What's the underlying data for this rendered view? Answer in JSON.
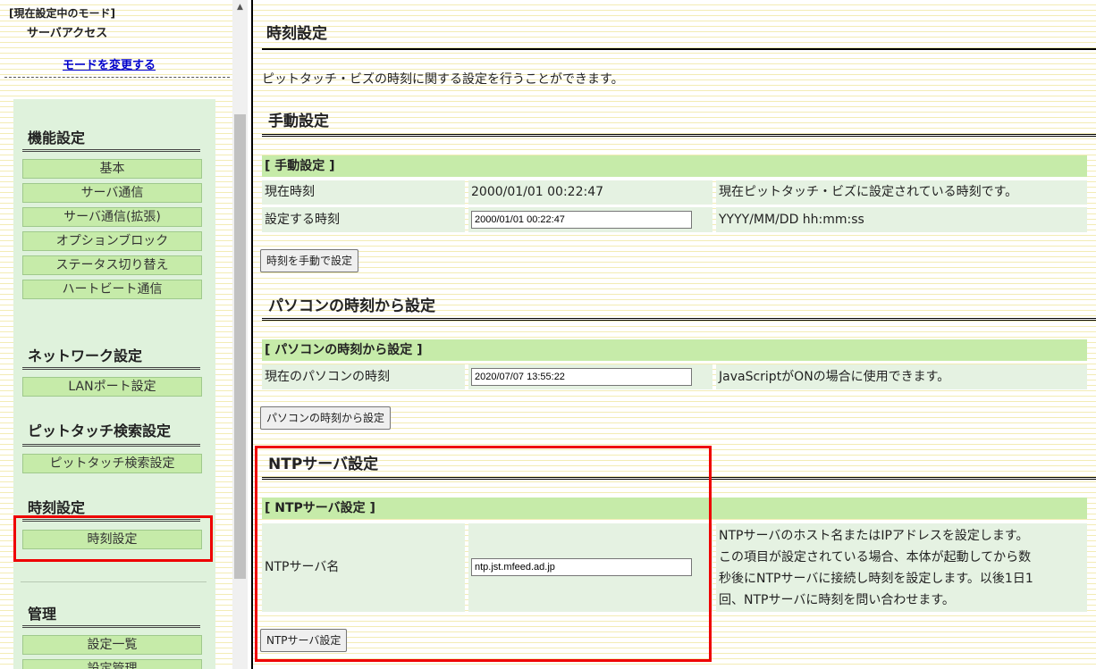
{
  "left": {
    "mode_label": "[現在設定中のモード]",
    "mode_value": "サーバアクセス",
    "change_mode_link": "モードを変更する",
    "sections": {
      "function": {
        "title": "機能設定",
        "items": [
          "基本",
          "サーバ通信",
          "サーバ通信(拡張)",
          "オプションブロック",
          "ステータス切り替え",
          "ハートビート通信"
        ]
      },
      "network": {
        "title": "ネットワーク設定",
        "items": [
          "LANポート設定"
        ]
      },
      "search": {
        "title": "ピットタッチ検索設定",
        "items": [
          "ピットタッチ検索設定"
        ]
      },
      "time": {
        "title": "時刻設定",
        "items": [
          "時刻設定"
        ]
      },
      "admin": {
        "title": "管理",
        "items": [
          "設定一覧",
          "設定管理"
        ]
      }
    }
  },
  "main": {
    "title": "時刻設定",
    "description": "ピットタッチ・ビズの時刻に関する設定を行うことができます。",
    "manual": {
      "heading": "手動設定",
      "table_header": "[ 手動設定 ]",
      "rows": [
        {
          "label": "現在時刻",
          "value": "2000/01/01 00:22:47",
          "desc": "現在ピットタッチ・ビズに設定されている時刻です。"
        },
        {
          "label": "設定する時刻",
          "input_value": "2000/01/01 00:22:47",
          "desc": "YYYY/MM/DD hh:mm:ss"
        }
      ],
      "button": "時刻を手動で設定"
    },
    "pc": {
      "heading": "パソコンの時刻から設定",
      "table_header": "[ パソコンの時刻から設定 ]",
      "row": {
        "label": "現在のパソコンの時刻",
        "input_value": "2020/07/07 13:55:22",
        "desc": "JavaScriptがONの場合に使用できます。"
      },
      "button": "パソコンの時刻から設定"
    },
    "ntp": {
      "heading": "NTPサーバ設定",
      "table_header": "[ NTPサーバ設定 ]",
      "row": {
        "label": "NTPサーバ名",
        "input_value": "ntp.jst.mfeed.ad.jp",
        "desc_lines": [
          "NTPサーバのホスト名またはIPアドレスを設定します。",
          "この項目が設定されている場合、本体が起動してから数",
          "秒後にNTPサーバに接続し時刻を設定します。以後1日1",
          "回、NTPサーバに時刻を問い合わせます。"
        ]
      },
      "button": "NTPサーバ設定"
    }
  },
  "colors": {
    "highlight": "#e00000",
    "menu_button": "#c6eba9",
    "table_header": "#c6eba9",
    "cell": "#e5f2e2",
    "link": "#0000cc"
  }
}
